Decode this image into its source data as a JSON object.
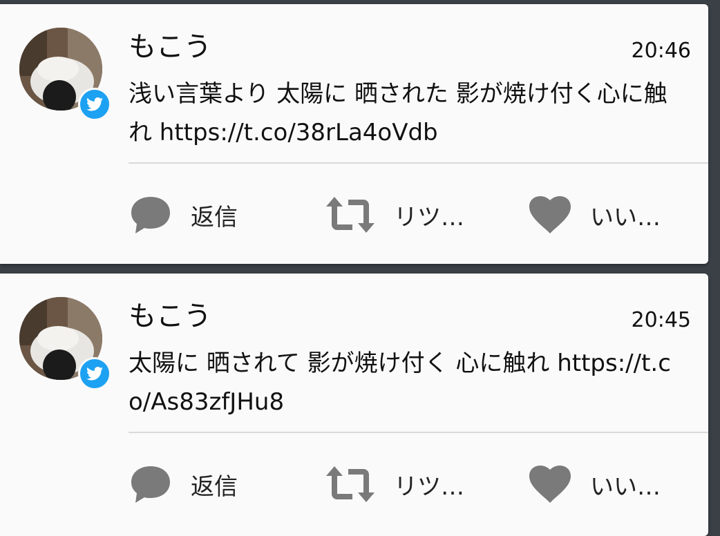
{
  "notifications": [
    {
      "user_name": "もこう",
      "time": "20:46",
      "text": "浅い言葉より 太陽に 晒された 影が焼け付く心に触れ https://t.co/38rLa4oVdb",
      "actions": {
        "reply_label": "返信",
        "retweet_label": "リツ…",
        "like_label": "いい…"
      }
    },
    {
      "user_name": "もこう",
      "time": "20:45",
      "text": "太陽に 晒されて 影が焼け付く 心に触れ https://t.co/As83zfJHu8",
      "actions": {
        "reply_label": "返信",
        "retweet_label": "リツ…",
        "like_label": "いい…"
      }
    }
  ],
  "colors": {
    "twitter_blue": "#1da1f2",
    "icon_gray": "#7a7a7a",
    "card_bg": "#fafafa",
    "backdrop": "#3a4046"
  },
  "icons": {
    "app_badge": "twitter-bird-icon",
    "reply": "speech-bubble-icon",
    "retweet": "retweet-icon",
    "like": "heart-icon"
  }
}
